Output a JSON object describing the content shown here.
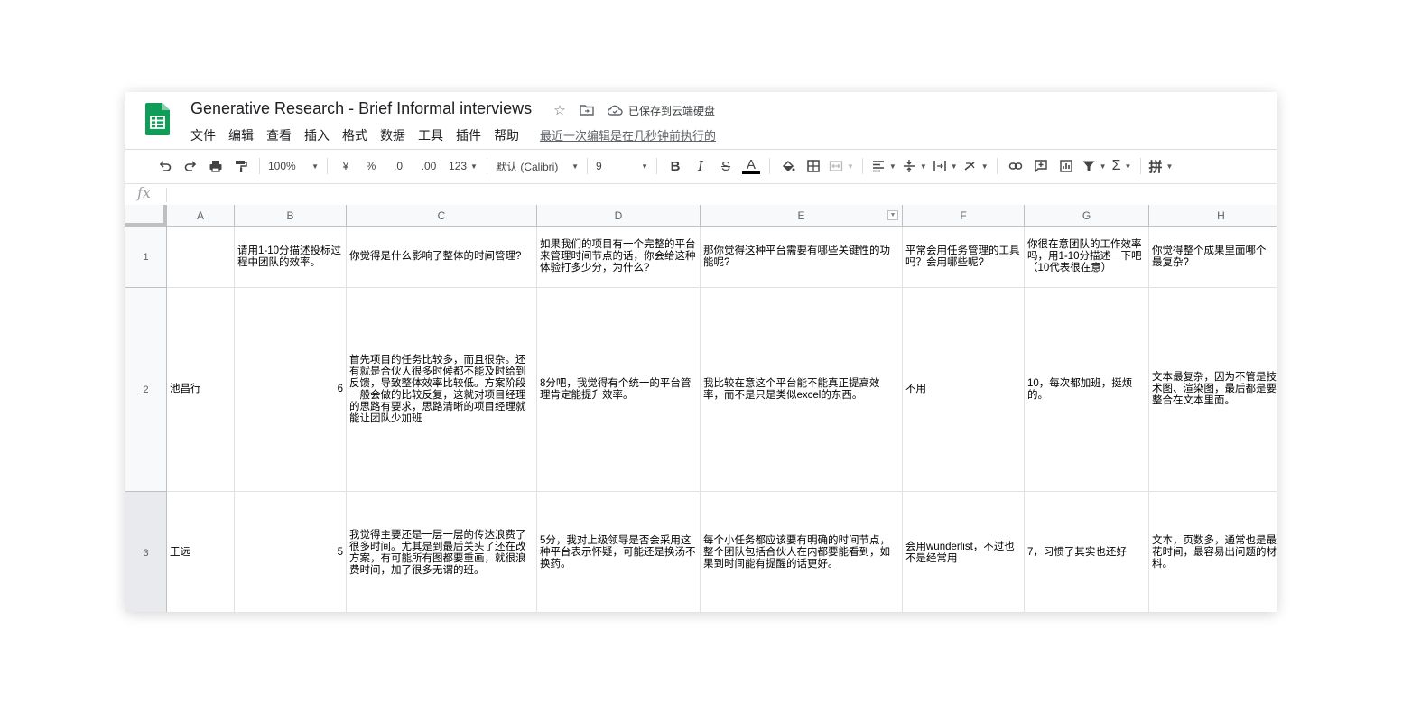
{
  "doc": {
    "title": "Generative Research - Brief Informal interviews",
    "save_status": "已保存到云端硬盘",
    "last_edit": "最近一次编辑是在几秒钟前执行的",
    "brand_color": "#0f9d58"
  },
  "menu": [
    "文件",
    "编辑",
    "查看",
    "插入",
    "格式",
    "数据",
    "工具",
    "插件",
    "帮助"
  ],
  "toolbar": {
    "zoom": "100%",
    "currency": "¥",
    "percent": "%",
    "dec_less": ".0",
    "dec_more": ".00",
    "format_more": "123",
    "font": "默认 (Calibri)",
    "font_size": "9",
    "bold": "B",
    "italic": "I",
    "strike": "S",
    "text_color_letter": "A",
    "input_tool": "拼"
  },
  "formula_bar": {
    "fx": "fx",
    "value": ""
  },
  "columns": [
    "A",
    "B",
    "C",
    "D",
    "E",
    "F",
    "G",
    "H"
  ],
  "rows": [
    {
      "num": "1",
      "cells": [
        "",
        "请用1-10分描述投标过程中团队的效率。",
        "你觉得是什么影响了整体的时间管理?",
        "如果我们的项目有一个完整的平台来管理时间节点的话，你会给这种体验打多少分，为什么?",
        "那你觉得这种平台需要有哪些关键性的功能呢?",
        "平常会用任务管理的工具吗？会用哪些呢?",
        "你很在意团队的工作效率吗，用1-10分描述一下吧（10代表很在意）",
        "你觉得整个成果里面哪个最复杂?"
      ]
    },
    {
      "num": "2",
      "cells": [
        "池昌行",
        "6",
        "首先项目的任务比较多，而且很杂。还有就是合伙人很多时候都不能及时给到反馈，导致整体效率比较低。方案阶段一般会做的比较反复，这就对项目经理的思路有要求，思路清晰的项目经理就能让团队少加班",
        "8分吧，我觉得有个统一的平台管理肯定能提升效率。",
        "我比较在意这个平台能不能真正提高效率，而不是只是类似excel的东西。",
        "不用",
        "10，每次都加班，挺烦的。",
        "文本最复杂，因为不管是技术图、渲染图，最后都是要整合在文本里面。"
      ]
    },
    {
      "num": "3",
      "cells": [
        "王远",
        "5",
        "我觉得主要还是一层一层的传达浪费了很多时间。尤其是到最后关头了还在改方案，有可能所有图都要重画，就很浪费时间，加了很多无谓的班。",
        "5分，我对上级领导是否会采用这种平台表示怀疑，可能还是换汤不换药。",
        "每个小任务都应该要有明确的时间节点，整个团队包括合伙人在内都要能看到，如果到时间能有提醒的话更好。",
        "会用wunderlist，不过也不是经常用",
        "7，习惯了其实也还好",
        "文本，页数多，通常也是最花时间，最容易出问题的材料。"
      ]
    }
  ]
}
